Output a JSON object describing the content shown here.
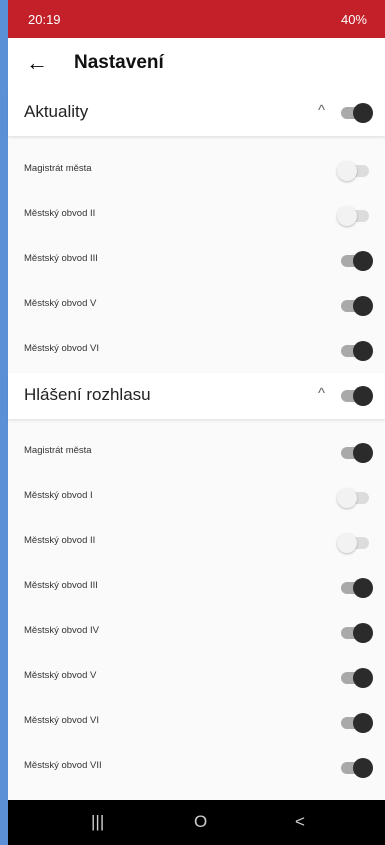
{
  "status": {
    "time": "20:19",
    "right": "40%"
  },
  "appbar": {
    "back_icon": "arrow-left-icon",
    "title": "Nastavení"
  },
  "sections": [
    {
      "label": "Aktuality",
      "expanded": true,
      "on": true,
      "items": [
        {
          "label": "Magistrát města",
          "on": false
        },
        {
          "label": "Městský obvod II",
          "on": false
        },
        {
          "label": "Městský obvod III",
          "on": true
        },
        {
          "label": "Městský obvod V",
          "on": true
        },
        {
          "label": "Městský obvod VI",
          "on": true
        }
      ]
    },
    {
      "label": "Hlášení rozhlasu",
      "expanded": true,
      "on": true,
      "items": [
        {
          "label": "Magistrát města",
          "on": true
        },
        {
          "label": "Městský obvod I",
          "on": false
        },
        {
          "label": "Městský obvod II",
          "on": false
        },
        {
          "label": "Městský obvod III",
          "on": true
        },
        {
          "label": "Městský obvod IV",
          "on": true
        },
        {
          "label": "Městský obvod V",
          "on": true
        },
        {
          "label": "Městský obvod VI",
          "on": true
        },
        {
          "label": "Městský obvod VII",
          "on": true
        }
      ]
    }
  ],
  "navbar": {
    "recents": "|||",
    "home": "O",
    "back": "<"
  },
  "colors": {
    "statusbar": "#c3202a",
    "accent_edge": "#5b8fd6"
  }
}
